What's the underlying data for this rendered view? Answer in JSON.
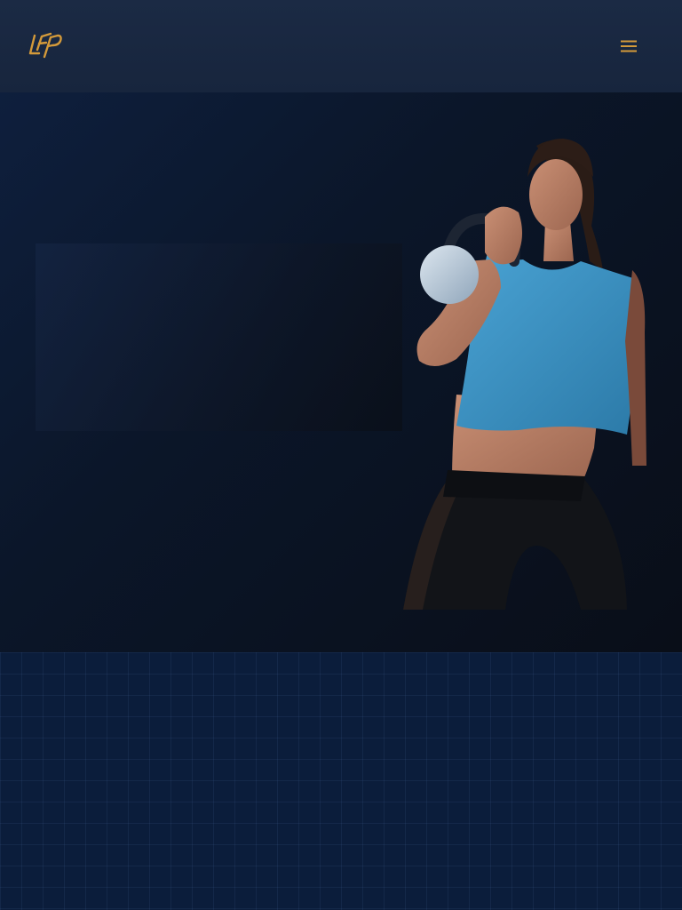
{
  "header": {
    "logo_icon": "lfp-logo-icon",
    "menu_icon": "hamburger-menu-icon"
  },
  "hero": {
    "image_icon": "woman-kettlebell-photo"
  },
  "colors": {
    "accent": "#d49a3a",
    "header_bg": "#1b2a44",
    "page_bg": "#0a1a35",
    "tank_top": "#3f94c4"
  }
}
